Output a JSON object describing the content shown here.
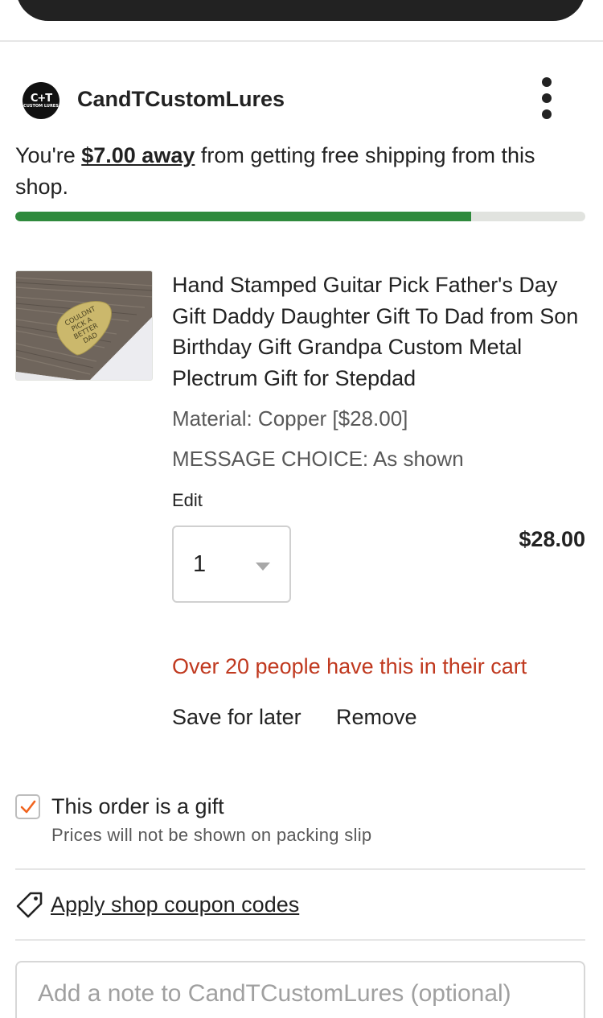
{
  "shop": {
    "name": "CandTCustomLures",
    "logo_monogram": "C+T",
    "logo_sub": "CUSTOM LURES",
    "menu_icon": "kebab-menu-icon"
  },
  "shipping": {
    "prefix": "You're ",
    "amount": "$7.00 away",
    "suffix": " from getting free shipping from this shop.",
    "progress_fraction": 0.8,
    "progress_color": "#2f8a3d"
  },
  "item": {
    "image_alt": "Brass guitar pick stamped COULDNT PICK A BETTER DAD on weathered wood",
    "image_text_lines": [
      "COULDNT",
      "PICK A",
      "BETTER",
      "DAD"
    ],
    "title": "Hand Stamped Guitar Pick Father's Day Gift Daddy Daughter Gift To Dad from Son Birthday Gift Grandpa Custom Metal Plectrum Gift for Stepdad",
    "variations": [
      "Material: Copper [$28.00]",
      "MESSAGE CHOICE: As shown"
    ],
    "edit_label": "Edit",
    "quantity": "1",
    "price": "$28.00",
    "cart_alert": "Over 20 people have this in their cart",
    "alert_color": "#c0391f",
    "save_for_later_label": "Save for later",
    "remove_label": "Remove"
  },
  "gift": {
    "checked": true,
    "label": "This order is a gift",
    "note": "Prices will not be shown on packing slip",
    "check_color": "#f1641e"
  },
  "coupon": {
    "icon": "tag-icon",
    "label": "Apply shop coupon codes"
  },
  "note": {
    "value": "",
    "placeholder": "Add a note to CandTCustomLures (optional)"
  }
}
